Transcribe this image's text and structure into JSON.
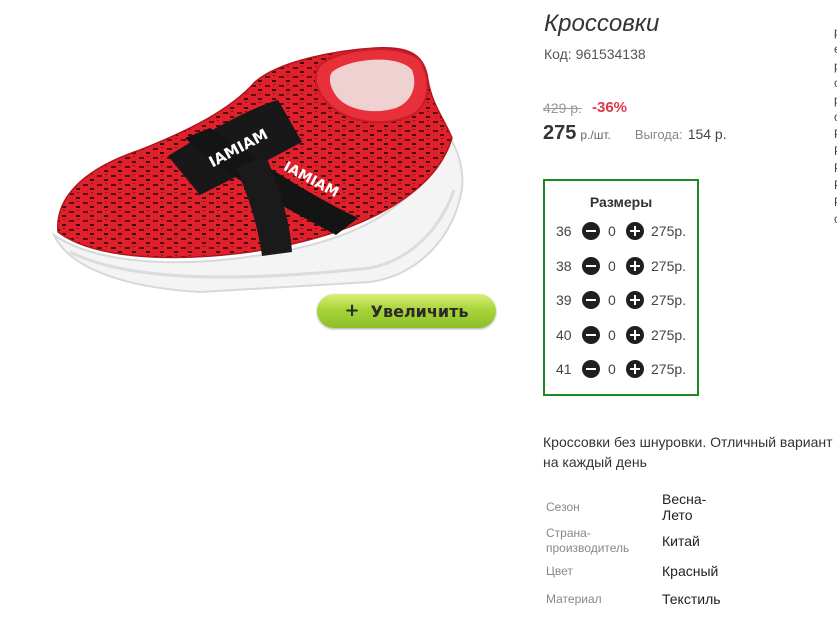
{
  "product": {
    "title": "Кроссовки",
    "code": "Код: 961534138",
    "image_alt": "Красные кроссовки без шнурков с надписью IAMIAM",
    "shoe_text": "IAMIAM"
  },
  "zoom_button": {
    "plus": "+",
    "label": "Увеличить"
  },
  "pricing": {
    "old_price": "429 р.",
    "discount": "-36%",
    "price": "275",
    "unit": "р./шт.",
    "savings_label": "Выгода:",
    "savings_value": "154 р."
  },
  "sizes": {
    "title": "Размеры",
    "rows": [
      {
        "size": "36",
        "qty": "0",
        "price": "275р."
      },
      {
        "size": "38",
        "qty": "0",
        "price": "275р."
      },
      {
        "size": "39",
        "qty": "0",
        "price": "275р."
      },
      {
        "size": "40",
        "qty": "0",
        "price": "275р."
      },
      {
        "size": "41",
        "qty": "0",
        "price": "275р."
      }
    ]
  },
  "description": "Кроссовки без шнуровки. Отличный вариант на каждый день",
  "attributes": [
    {
      "label": "Сезон",
      "value": "Весна-Лето"
    },
    {
      "label": "Страна-производитель",
      "value": "Китай"
    },
    {
      "label": "Цвет",
      "value": "Красный"
    },
    {
      "label": "Материал",
      "value": "Текстиль"
    }
  ],
  "edge_column": [
    "р",
    "е",
    "р",
    "с",
    "р",
    "с",
    "Р",
    "Р",
    "Р",
    "Р",
    "Р",
    "с"
  ],
  "colors": {
    "accent_green": "#1b8a21",
    "discount_red": "#e0364b",
    "zoom_button": "#a9d43a"
  }
}
